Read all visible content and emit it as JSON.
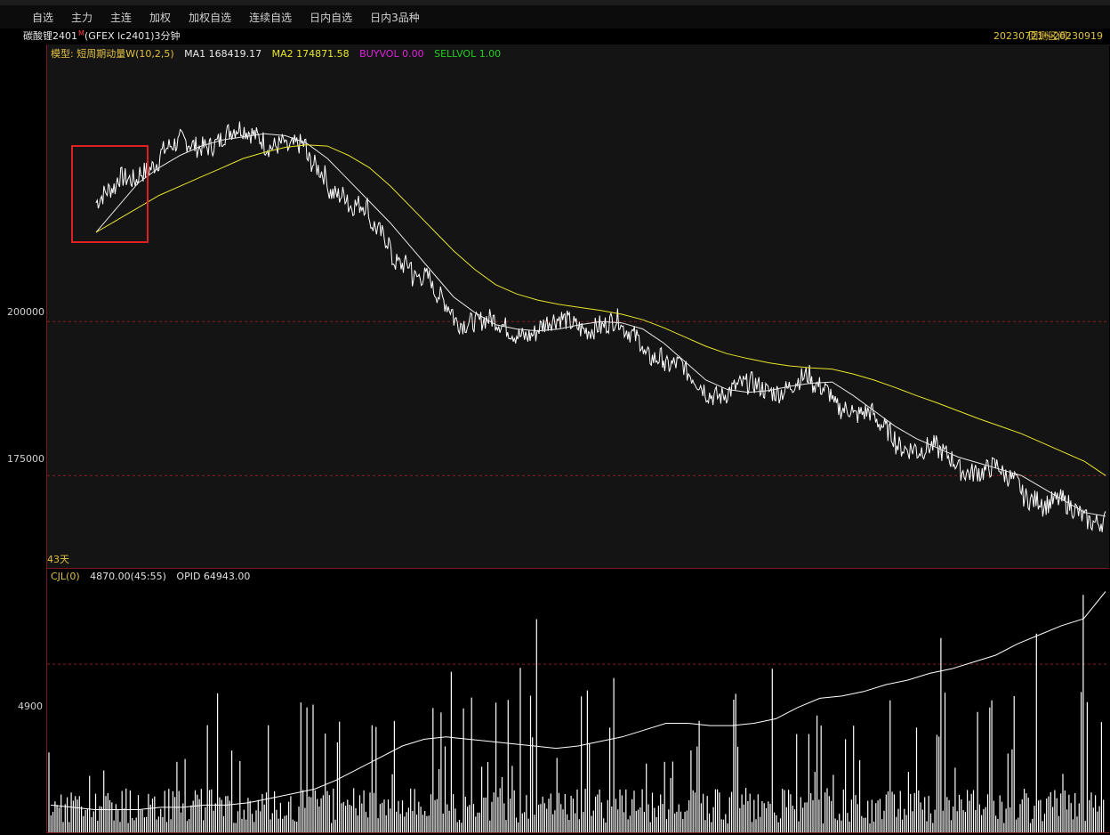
{
  "menu": [
    "自选",
    "主力",
    "主连",
    "加权",
    "加权自选",
    "连续自选",
    "日内自选",
    "日内3品种"
  ],
  "title": {
    "name": "碳酸锂2401",
    "mark": "M",
    "code": "(GFEX lc2401)3分钟",
    "backtest_label": "回测区间:",
    "backtest_range": "20230721～20230919"
  },
  "legend": {
    "model": "模型: 短周期动量W(10,2,5)",
    "ma1": "MA1 168419.17",
    "ma2": "MA2 174871.58",
    "buyvol": "BUYVOL 0.00",
    "sellvol": "SELLVOL 1.00"
  },
  "sub_legend": {
    "name": "CJL(0)",
    "value": "4870.00(45:55)",
    "opid": "OPID 64943.00"
  },
  "axis": {
    "main": [
      "200000",
      "175000"
    ],
    "sub": [
      "4900"
    ]
  },
  "days": "43天",
  "colors": {
    "price": "#ffffff",
    "ma1": "#e8e8e8",
    "ma2": "#e6e62a",
    "buyvol": "#e020e0",
    "sellvol": "#20d020",
    "legend_model": "#e0c040",
    "grid": "#8a1c1c",
    "highlight_box": "#e02020"
  },
  "chart_data": [
    {
      "type": "line",
      "title": "",
      "series": [
        {
          "name": "MA1",
          "values": [
            214500,
            218500,
            222500,
            225000,
            227000,
            228500,
            229500,
            230000,
            230500,
            230200,
            229000,
            226500,
            223000,
            219500,
            216000,
            212000,
            208000,
            204000,
            201500,
            199500,
            198800,
            198500,
            198800,
            199500,
            200000,
            199800,
            198800,
            196500,
            193500,
            190500,
            189000,
            188500,
            188800,
            189500,
            190000,
            190200,
            188000,
            185500,
            183000,
            181000,
            179500,
            178000,
            177000,
            176000,
            175000,
            173000,
            171000,
            169000,
            168400
          ]
        },
        {
          "name": "MA2",
          "values": [
            214500,
            216500,
            218500,
            220500,
            222000,
            223500,
            225000,
            226500,
            227500,
            228300,
            228700,
            228500,
            227000,
            225000,
            222000,
            218500,
            215000,
            211500,
            208500,
            206000,
            204500,
            203500,
            202800,
            202300,
            201800,
            201200,
            200300,
            199000,
            197500,
            196000,
            194800,
            194000,
            193300,
            192800,
            192500,
            192300,
            191500,
            190500,
            189300,
            188000,
            186800,
            185500,
            184200,
            183000,
            181800,
            180300,
            178800,
            177300,
            175000
          ]
        }
      ],
      "ylim": [
        160000,
        245000
      ],
      "yticks": [
        200000,
        175000
      ]
    },
    {
      "type": "bar",
      "title": "",
      "series": [
        {
          "name": "OPID",
          "values": [
            1800,
            1750,
            1700,
            1700,
            1700,
            1750,
            1750,
            1800,
            1800,
            1850,
            1950,
            2050,
            2150,
            2350,
            2600,
            2850,
            3100,
            3250,
            3300,
            3250,
            3200,
            3150,
            3100,
            3050,
            3100,
            3200,
            3300,
            3450,
            3600,
            3600,
            3550,
            3550,
            3600,
            3700,
            3950,
            4150,
            4200,
            4300,
            4450,
            4550,
            4700,
            4800,
            4950,
            5100,
            5350,
            5550,
            5750,
            5900,
            6500
          ]
        }
      ],
      "yticks": [
        4900
      ],
      "ylim": [
        1200,
        7000
      ]
    }
  ]
}
